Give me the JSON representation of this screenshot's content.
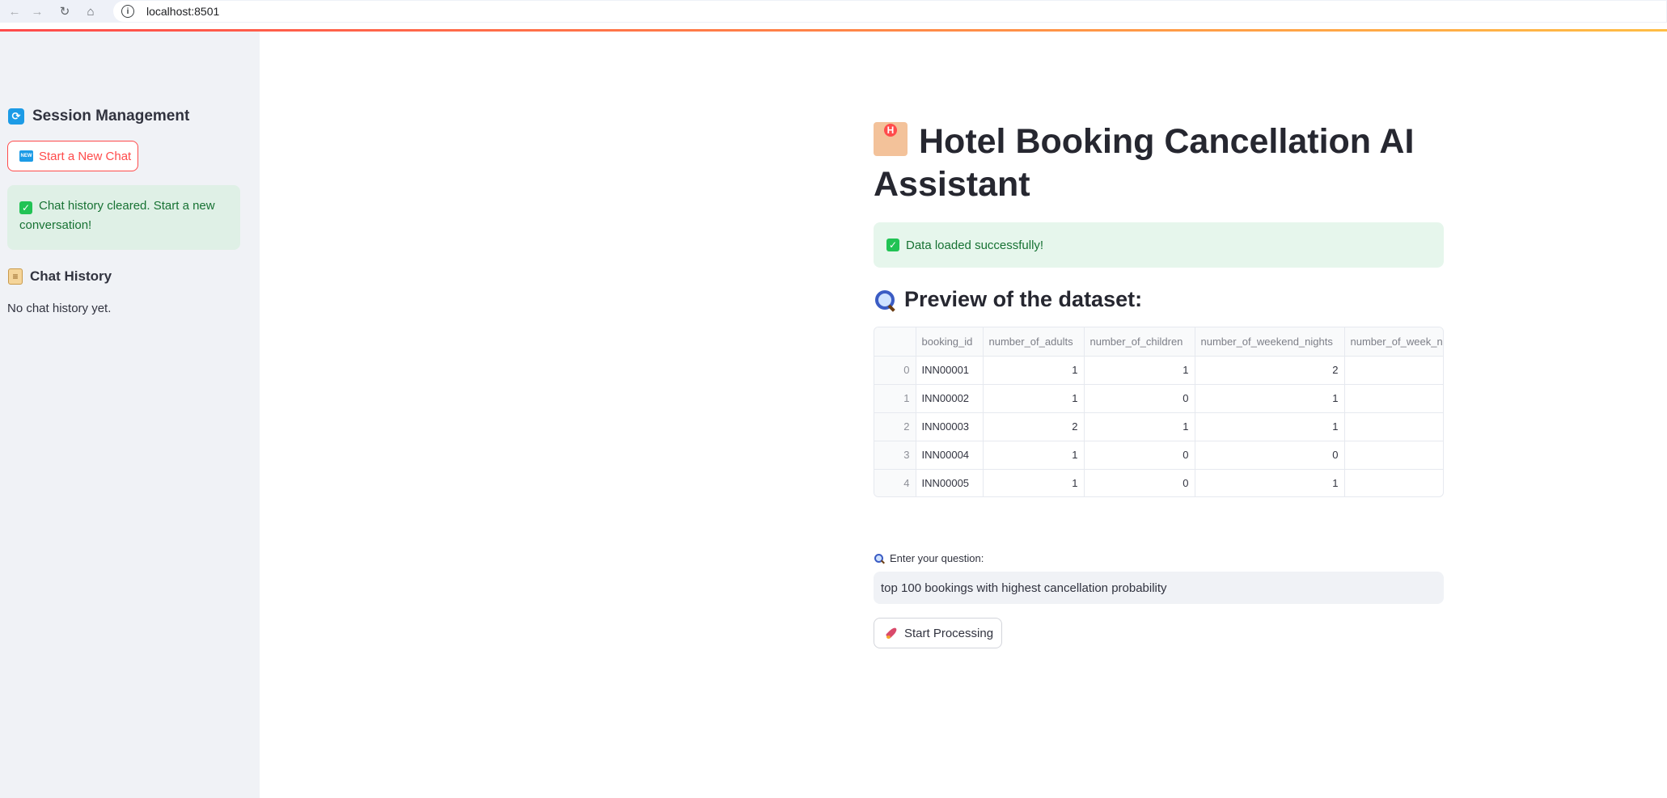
{
  "browser": {
    "url": "localhost:8501",
    "icons": [
      "back-arrow-icon",
      "forward-arrow-icon",
      "reload-icon",
      "home-icon",
      "info-icon"
    ]
  },
  "sidebar": {
    "session_header": "Session Management",
    "new_chat_button": "Start a New Chat",
    "success_message": "Chat history cleared. Start a new conversation!",
    "history_header": "Chat History",
    "empty_history": "No chat history yet."
  },
  "main": {
    "title": "Hotel Booking Cancellation AI Assistant",
    "success_message": "Data loaded successfully!",
    "preview_title": "Preview of the dataset:",
    "question_label": "Enter your question:",
    "question_value": "top 100 bookings with highest cancellation probability",
    "start_button": "Start Processing"
  },
  "table": {
    "columns": [
      "",
      "booking_id",
      "number_of_adults",
      "number_of_children",
      "number_of_weekend_nights",
      "number_of_week_nights"
    ],
    "rows": [
      [
        "0",
        "INN00001",
        "1",
        "1",
        "2",
        ""
      ],
      [
        "1",
        "INN00002",
        "1",
        "0",
        "1",
        ""
      ],
      [
        "2",
        "INN00003",
        "2",
        "1",
        "1",
        ""
      ],
      [
        "3",
        "INN00004",
        "1",
        "0",
        "0",
        ""
      ],
      [
        "4",
        "INN00005",
        "1",
        "0",
        "1",
        ""
      ]
    ]
  },
  "colors": {
    "accent": "#ff4b4b",
    "success_bg": "#dff0e6",
    "success_text": "#177233",
    "sidebar_bg": "#f0f2f6"
  }
}
